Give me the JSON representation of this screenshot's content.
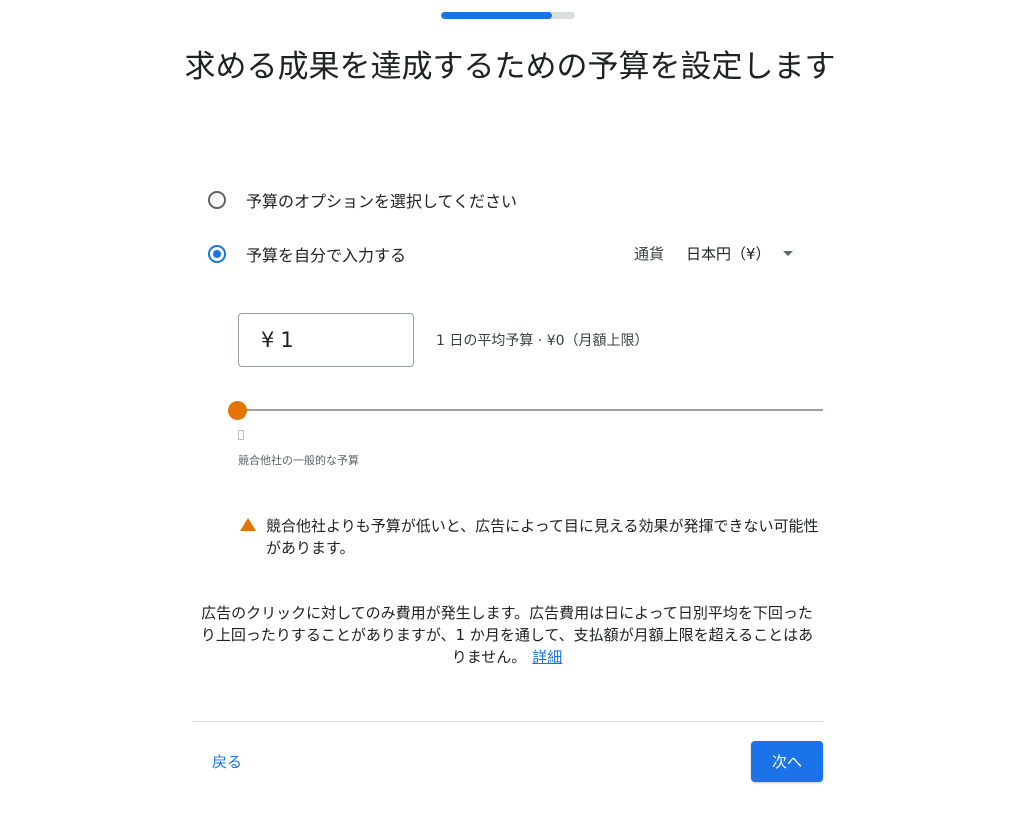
{
  "progress": {
    "fraction": 0.83
  },
  "title": "求める成果を達成するための予算を設定します",
  "options": [
    {
      "label": "予算のオプションを選択してください",
      "selected": false
    },
    {
      "label": "予算を自分で入力する",
      "selected": true
    }
  ],
  "currency": {
    "label": "通貨",
    "value": "日本円（¥）"
  },
  "amount": {
    "symbol": "¥",
    "value": "1"
  },
  "daily_average": "1 日の平均予算 · ¥0（月額上限）",
  "slider": {
    "value": 0,
    "competitor_label": "競合他社の一般的な予算"
  },
  "warning": {
    "text": "競合他社よりも予算が低いと、広告によって目に見える効果が発揮できない可能性があります。"
  },
  "info": {
    "text": "広告のクリックに対してのみ費用が発生します。広告費用は日によって日別平均を下回ったり上回ったりすることがありますが、1 か月を通して、支払額が月額上限を超えることはありません。",
    "link": "詳細"
  },
  "footer": {
    "back_label": "戻る",
    "next_label": "次へ"
  },
  "colors": {
    "accent": "#1a73e8",
    "warning": "#e37400"
  }
}
